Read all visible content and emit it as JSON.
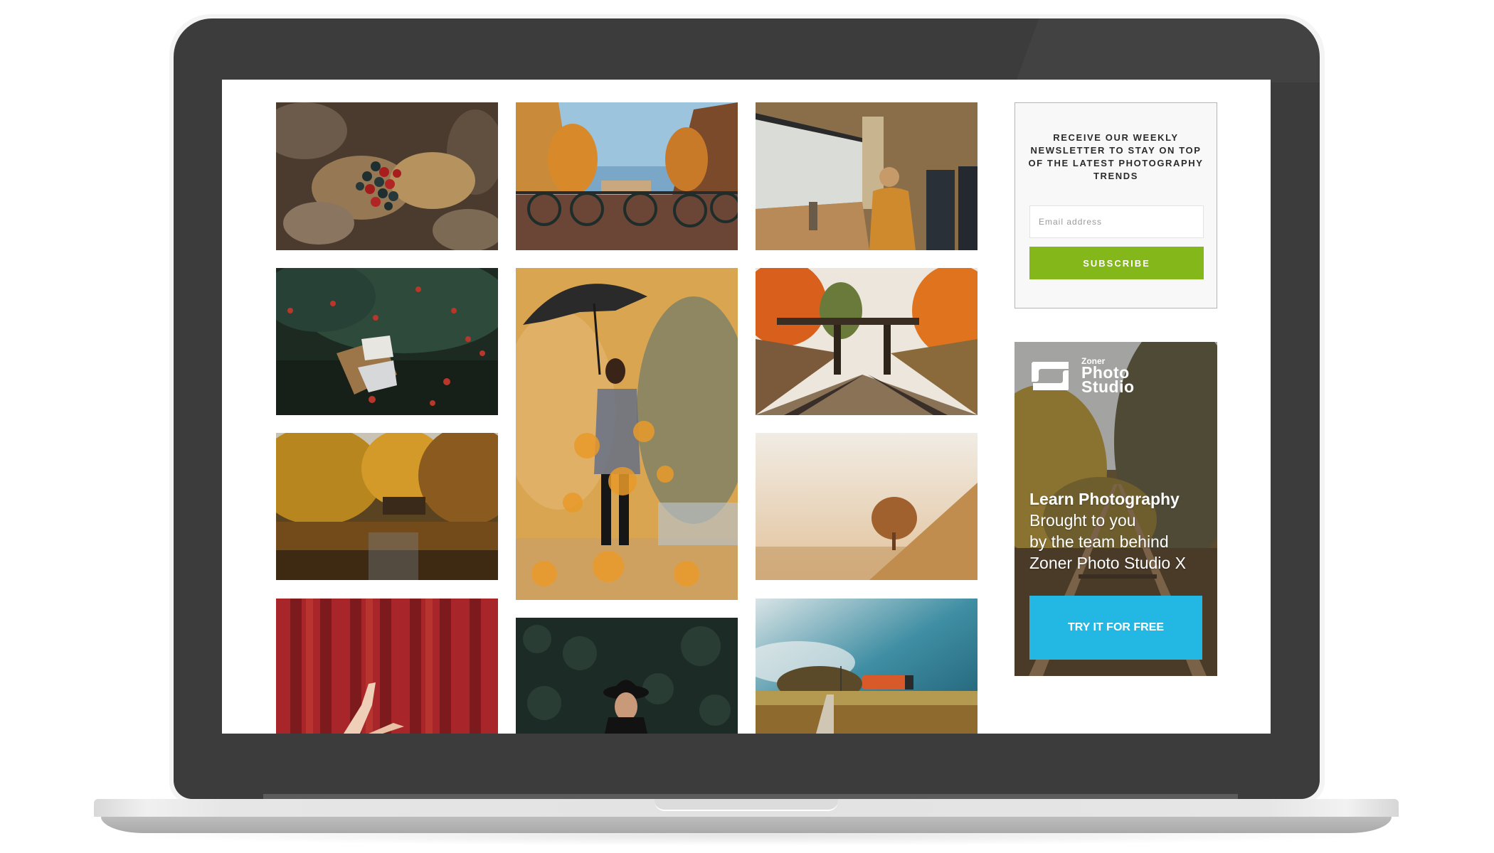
{
  "device": {
    "type": "laptop-mockup",
    "colors": {
      "bezel": "#3c3c3c",
      "base": "#e2e2e2",
      "screen_bg": "#ffffff"
    }
  },
  "gallery": {
    "photos": [
      {
        "id": "berries",
        "alt": "Red and black berries among dry autumn leaves",
        "column": 1,
        "row": 1
      },
      {
        "id": "canal-bikes",
        "alt": "Bicycles on a canal bridge with autumn trees and houses",
        "column": 2,
        "row": 1
      },
      {
        "id": "train-window",
        "alt": "Woman with headphones looking out a train window",
        "column": 3,
        "row": 1
      },
      {
        "id": "apple-picnic",
        "alt": "Picnic basket with a book under an apple tree",
        "column": 1,
        "row": 2
      },
      {
        "id": "umbrella-leaves",
        "alt": "Woman with black umbrella among falling autumn leaves",
        "column": 2,
        "row": 2
      },
      {
        "id": "rail-bridge",
        "alt": "Railway tracks under a wooden bridge with orange trees",
        "column": 3,
        "row": 2
      },
      {
        "id": "lake-reflection",
        "alt": "Autumn forest reflected in a calm lake",
        "column": 1,
        "row": 3
      },
      {
        "id": "hazy-hill",
        "alt": "Lone tree on a hazy golden hillside",
        "column": 3,
        "row": 3
      },
      {
        "id": "red-wall",
        "alt": "Hands reaching against a red corrugated wall",
        "column": 1,
        "row": 4
      },
      {
        "id": "hat-portrait",
        "alt": "Woman in a black hat in front of dark ivy",
        "column": 2,
        "row": 3
      },
      {
        "id": "train-field",
        "alt": "Red train passing golden fields under a teal sky",
        "column": 3,
        "row": 4
      }
    ]
  },
  "newsletter": {
    "heading": "RECEIVE OUR WEEKLY NEWSLETTER TO STAY ON TOP OF THE LATEST PHOTOGRAPHY TRENDS",
    "email_placeholder": "Email address",
    "email_value": "",
    "subscribe_label": "SUBSCRIBE",
    "button_color": "#84b71a"
  },
  "ad": {
    "logo": {
      "line1": "Zoner",
      "line2": "Photo",
      "line3": "Studio"
    },
    "headline": "Learn Photography",
    "body_lines": [
      "Brought to you",
      "by the team behind",
      "Zoner Photo Studio X"
    ],
    "cta_label": "TRY IT FOR FREE",
    "cta_color": "#22b8e3"
  }
}
